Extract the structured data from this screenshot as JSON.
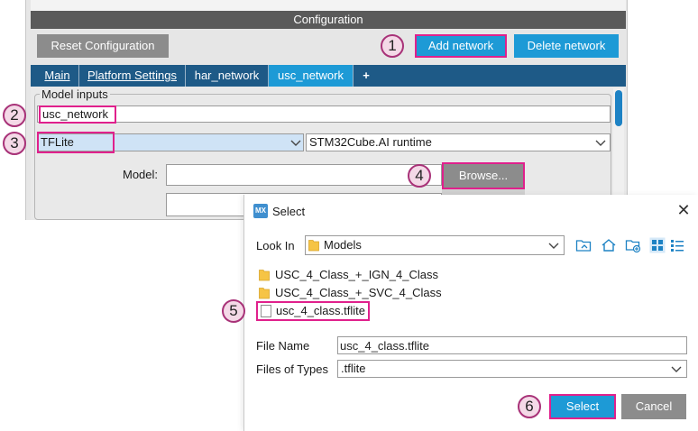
{
  "config": {
    "title": "Configuration",
    "reset_label": "Reset Configuration",
    "add_network_label": "Add network",
    "delete_network_label": "Delete network",
    "tabs": [
      {
        "label": "Main"
      },
      {
        "label": "Platform Settings"
      },
      {
        "label": "har_network"
      },
      {
        "label": "usc_network",
        "active": true
      },
      {
        "label": "+"
      }
    ],
    "model_inputs": {
      "legend": "Model inputs",
      "network_name": "usc_network",
      "framework": "TFLite",
      "runtime": "STM32Cube.AI runtime",
      "model_label": "Model:",
      "browse_label": "Browse..."
    }
  },
  "callouts": [
    "1",
    "2",
    "3",
    "4",
    "5",
    "6"
  ],
  "dialog": {
    "app_icon_text": "MX",
    "title": "Select",
    "close_glyph": "✕",
    "look_in_label": "Look In",
    "look_in_value": "Models",
    "toolbar_icons": [
      "up-folder-icon",
      "home-icon",
      "new-folder-icon",
      "list-view-icon",
      "details-view-icon"
    ],
    "files": [
      {
        "name": "USC_4_Class_+_IGN_4_Class",
        "type": "folder"
      },
      {
        "name": "USC_4_Class_+_SVC_4_Class",
        "type": "folder"
      },
      {
        "name": "usc_4_class.tflite",
        "type": "file"
      }
    ],
    "file_name_label": "File Name",
    "file_name_value": "usc_4_class.tflite",
    "files_of_type_label": "Files of Types",
    "files_of_type_value": ".tflite",
    "select_label": "Select",
    "cancel_label": "Cancel"
  },
  "colors": {
    "accent_blue": "#1d9ad6",
    "tab_bar": "#1e5a87",
    "highlight": "#e0208c",
    "gray_button": "#8c8c8c",
    "folder": "#f6c445"
  }
}
